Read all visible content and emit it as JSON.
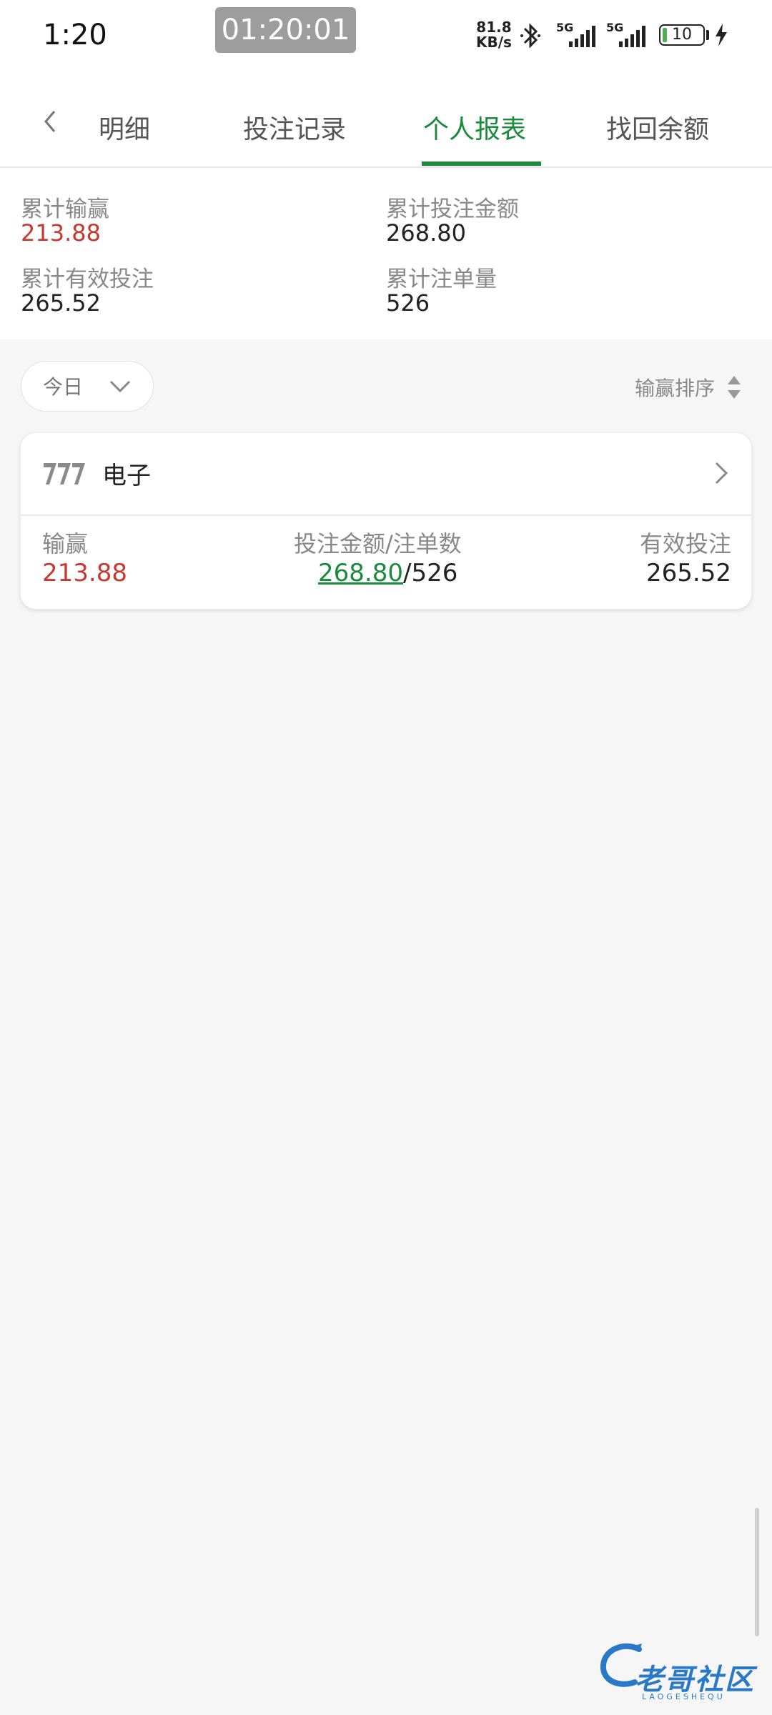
{
  "status_bar": {
    "time": "1:20",
    "timer": "01:20:01",
    "network_speed_value": "81.8",
    "network_speed_unit": "KB/s",
    "signal1_label": "5G",
    "signal2_label": "5G",
    "battery_level": "10"
  },
  "tabs": [
    {
      "label": "明细"
    },
    {
      "label": "投注记录"
    },
    {
      "label": "个人报表",
      "active": true
    },
    {
      "label": "找回余额"
    }
  ],
  "summary": {
    "total_win_loss_label": "累计输赢",
    "total_win_loss_value": "213.88",
    "total_bet_amount_label": "累计投注金额",
    "total_bet_amount_value": "268.80",
    "total_valid_bet_label": "累计有效投注",
    "total_valid_bet_value": "265.52",
    "total_order_count_label": "累计注单量",
    "total_order_count_value": "526"
  },
  "filter": {
    "period_label": "今日",
    "sort_label": "输赢排序"
  },
  "card": {
    "title": "电子",
    "win_loss_label": "输赢",
    "win_loss_value": "213.88",
    "bet_label": "投注金额/注单数",
    "bet_amount": "268.80",
    "bet_separator": "/",
    "bet_count": "526",
    "valid_bet_label": "有效投注",
    "valid_bet_value": "265.52"
  },
  "watermark": {
    "text": "老哥社区",
    "sub": "LAOGESHEQU"
  },
  "colors": {
    "accent_green": "#1a8a3b",
    "value_red": "#c9382f",
    "background": "#f6f6f6"
  }
}
